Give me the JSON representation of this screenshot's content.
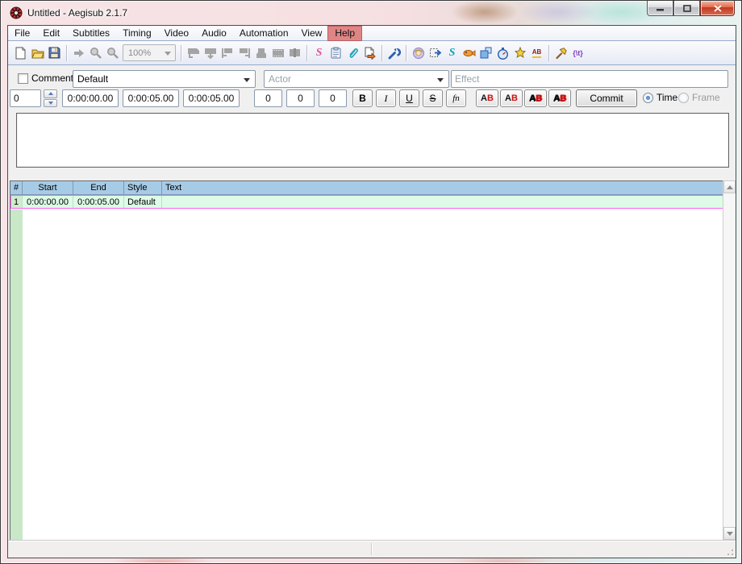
{
  "window": {
    "title": "Untitled - Aegisub 2.1.7"
  },
  "menu": {
    "items": [
      "File",
      "Edit",
      "Subtitles",
      "Timing",
      "Video",
      "Audio",
      "Automation",
      "View",
      "Help"
    ],
    "highlighted_item": "Help"
  },
  "toolbar": {
    "zoom_value": "100%",
    "icons": [
      "new-file",
      "open-file",
      "save-file",
      "jump-to",
      "zoom-in",
      "zoom-out",
      "zoom-select",
      "video-jump-start",
      "video-jump-end",
      "snap-start-to-video",
      "snap-end-to-video",
      "select-visible-lines",
      "snap-to-scene",
      "shift-to-frame",
      "styles-manager",
      "properties",
      "attachments",
      "fonts-collector",
      "automation",
      "spell-checker",
      "select-lines",
      "shift-times",
      "kanji-timer",
      "resample-resolution",
      "timing-postprocessor",
      "translation-assistant",
      "styling-assistant",
      "options",
      "tag-toggle"
    ],
    "glyphs": {
      "styles_manager": "S",
      "shift_times": "S",
      "styling_assistant": "AB",
      "tag_toggle": "{\\t}"
    }
  },
  "editbox": {
    "comment_label": "Comment",
    "style_value": "Default",
    "actor_placeholder": "Actor",
    "effect_placeholder": "Effect",
    "layer": "0",
    "start_time": "0:00:00.00",
    "end_time": "0:00:05.00",
    "duration": "0:00:05.00",
    "margin_left": "0",
    "margin_right": "0",
    "margin_vertical": "0",
    "format_buttons": [
      "B",
      "I",
      "U",
      "S",
      "fn"
    ],
    "color_buttons": [
      {
        "a": "A",
        "b": "B"
      },
      {
        "a": "A",
        "b": "B"
      },
      {
        "a": "A",
        "b": "B"
      },
      {
        "a": "A",
        "b": "B"
      }
    ],
    "commit_label": "Commit",
    "time_label": "Time",
    "frame_label": "Frame",
    "text_value": ""
  },
  "grid": {
    "columns": [
      "#",
      "Start",
      "End",
      "Style",
      "Text"
    ],
    "rows": [
      {
        "num": "1",
        "start": "0:00:00.00",
        "end": "0:00:05.00",
        "style": "Default",
        "text": ""
      }
    ]
  },
  "colors": {
    "help_highlight": "#df8585",
    "grid_header_bg": "#a6cbe6",
    "selected_row_bg": "#ddfbe6",
    "selected_row_border": "#ff62f0",
    "gutter_bg": "#c8e8c8",
    "close_button": "#c03a22"
  }
}
